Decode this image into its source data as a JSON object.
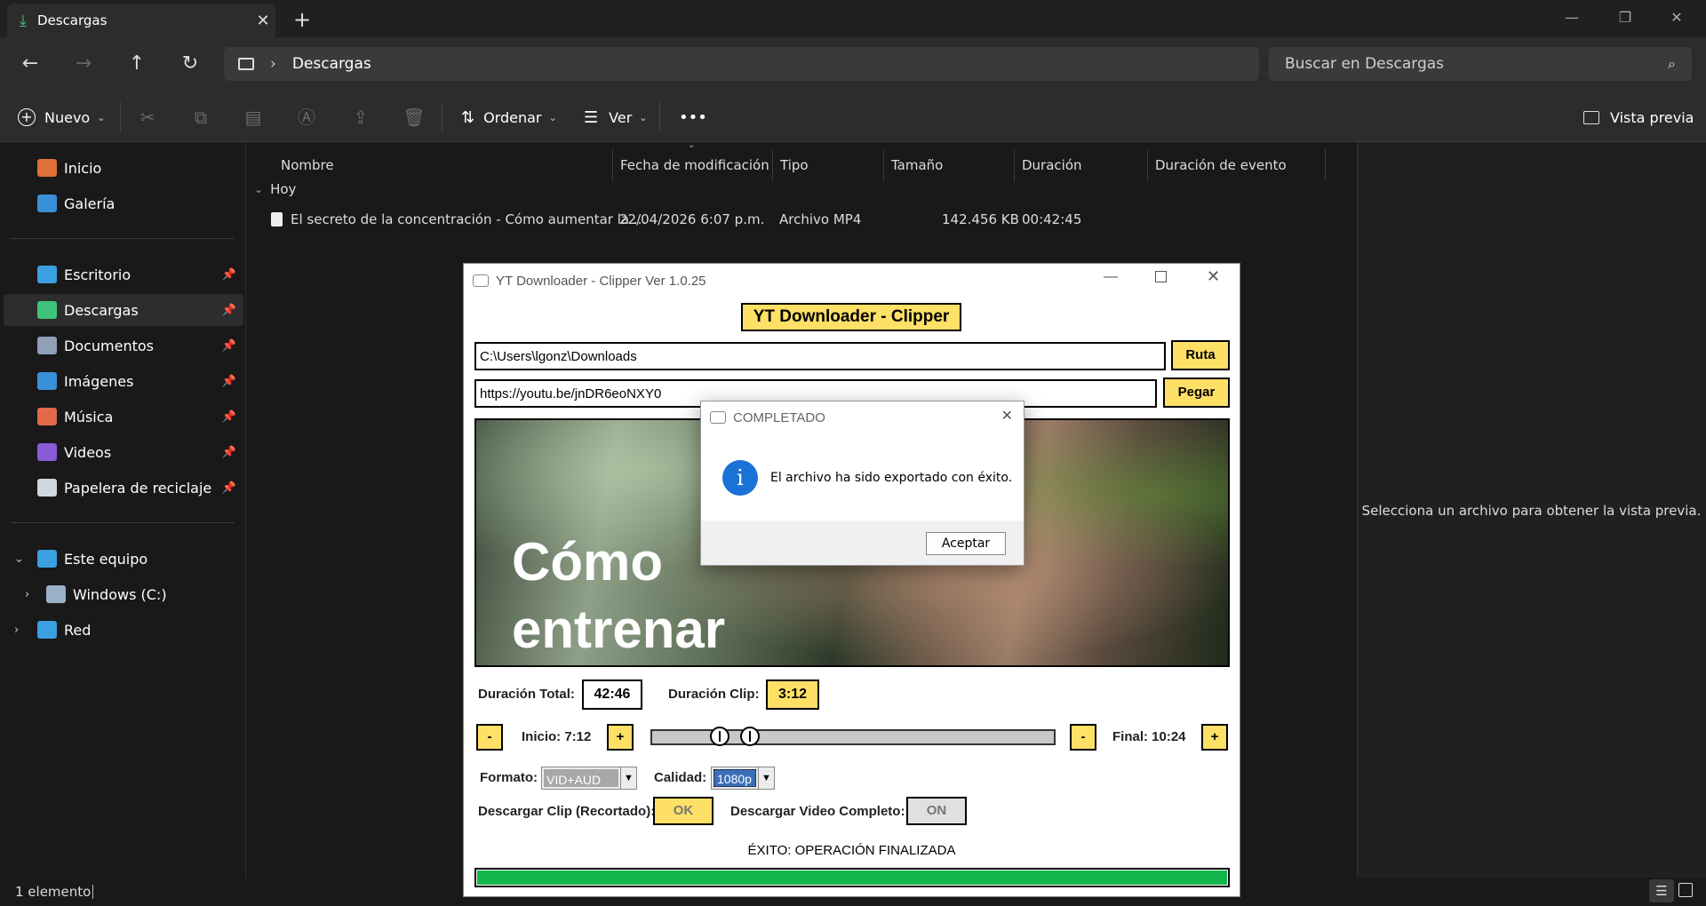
{
  "explorer": {
    "tab_title": "Descargas",
    "address_segment": "Descargas",
    "search_placeholder": "Buscar en Descargas",
    "toolbar": {
      "new_label": "Nuevo",
      "sort_label": "Ordenar",
      "view_label": "Ver",
      "more_label": "•••",
      "preview_label": "Vista previa"
    },
    "sidebar": {
      "items": [
        {
          "label": "Inicio",
          "icon": "home-icon",
          "color": "#e0703a"
        },
        {
          "label": "Galería",
          "icon": "gallery-icon",
          "color": "#3a8fd9"
        },
        {
          "label": "Escritorio",
          "icon": "desktop-icon",
          "color": "#3aa0e0"
        },
        {
          "label": "Descargas",
          "icon": "download-icon",
          "color": "#3ec47a"
        },
        {
          "label": "Documentos",
          "icon": "documents-icon",
          "color": "#8fa0b8"
        },
        {
          "label": "Imágenes",
          "icon": "pictures-icon",
          "color": "#3a8fd9"
        },
        {
          "label": "Música",
          "icon": "music-icon",
          "color": "#e06a4a"
        },
        {
          "label": "Videos",
          "icon": "videos-icon",
          "color": "#8a5ad9"
        },
        {
          "label": "Papelera de reciclaje",
          "icon": "recycle-bin-icon",
          "color": "#cfd8e0"
        },
        {
          "label": "Este equipo",
          "icon": "computer-icon",
          "color": "#3aa0e0"
        },
        {
          "label": "Windows (C:)",
          "icon": "drive-icon",
          "color": "#9ab0c8"
        },
        {
          "label": "Red",
          "icon": "network-icon",
          "color": "#3aa0e0"
        }
      ]
    },
    "columns": [
      "Nombre",
      "Fecha de modificación",
      "Tipo",
      "Tamaño",
      "Duración",
      "Duración de evento"
    ],
    "group_label": "Hoy",
    "file": {
      "name": "El secreto de la concentración - Cómo aumentar la ...",
      "date": "22/04/2026 6:07 p.m.",
      "type": "Archivo MP4",
      "size": "142.456 KB",
      "duration": "00:42:45"
    },
    "preview_message": "Selecciona un archivo para obtener la vista previa.",
    "status_count": "1 elemento"
  },
  "app": {
    "window_title": "YT Downloader - Clipper Ver 1.0.25",
    "banner": "YT Downloader - Clipper",
    "path_value": "C:\\Users\\lgonz\\Downloads",
    "path_button": "Ruta",
    "url_value": "https://youtu.be/jnDR6eoNXY0",
    "paste_button": "Pegar",
    "thumbnail_text": [
      "Cómo",
      "entrenar"
    ],
    "total_duration_label": "Duración Total:",
    "total_duration_value": "42:46",
    "clip_duration_label": "Duración Clip:",
    "clip_duration_value": "3:12",
    "minus": "-",
    "plus": "+",
    "start_label": "Inicio: 7:12",
    "end_label": "Final: 10:24",
    "format_label": "Formato:",
    "format_value": "VID+AUD",
    "quality_label": "Calidad:",
    "quality_value": "1080p",
    "download_clip_label": "Descargar Clip (Recortado):",
    "download_clip_button": "OK",
    "download_full_label": "Descargar Video Completo:",
    "download_full_button": "ON",
    "status_text": "ÉXITO: OPERACIÓN FINALIZADA",
    "progress": 1.0
  },
  "dialog": {
    "title": "COMPLETADO",
    "message": "El archivo ha sido exportado con éxito.",
    "ok_button": "Aceptar"
  }
}
